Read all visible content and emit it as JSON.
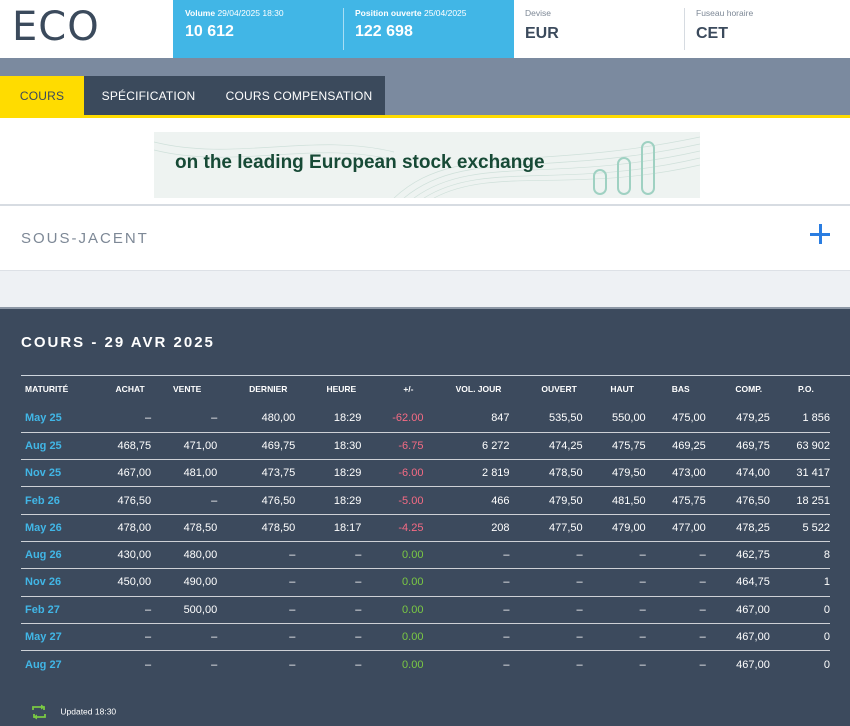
{
  "header": {
    "code": "ECO",
    "volume": {
      "label": "Volume",
      "date": "29/04/2025 18:30",
      "value": "10 612"
    },
    "open_interest": {
      "label": "Position ouverte",
      "date": "25/04/2025",
      "value": "122 698"
    },
    "currency": {
      "label": "Devise",
      "value": "EUR"
    },
    "timezone": {
      "label": "Fuseau horaire",
      "value": "CET"
    }
  },
  "tabs": [
    {
      "label": "COURS",
      "active": true
    },
    {
      "label": "SPÉCIFICATION",
      "active": false
    },
    {
      "label": "COURS COMPENSATION",
      "active": false
    }
  ],
  "banner": {
    "text": "on the leading European stock exchange"
  },
  "underlying": {
    "title": "SOUS-JACENT"
  },
  "prices": {
    "title": "COURS - 29 AVR 2025",
    "columns": [
      "MATURITÉ",
      "ACHAT",
      "VENTE",
      "DERNIER",
      "HEURE",
      "+/-",
      "VOL. JOUR",
      "OUVERT",
      "HAUT",
      "BAS",
      "COMP.",
      "P.O."
    ],
    "rows": [
      {
        "maturity": "May 25",
        "bid": "–",
        "ask": "–",
        "last": "480,00",
        "time": "18:29",
        "change": "-62.00",
        "volume": "847",
        "open": "535,50",
        "high": "550,00",
        "low": "475,00",
        "settle": "479,25",
        "oi": "1 856",
        "dir": "neg"
      },
      {
        "maturity": "Aug 25",
        "bid": "468,75",
        "ask": "471,00",
        "last": "469,75",
        "time": "18:30",
        "change": "-6.75",
        "volume": "6 272",
        "open": "474,25",
        "high": "475,75",
        "low": "469,25",
        "settle": "469,75",
        "oi": "63 902",
        "dir": "neg"
      },
      {
        "maturity": "Nov 25",
        "bid": "467,00",
        "ask": "481,00",
        "last": "473,75",
        "time": "18:29",
        "change": "-6.00",
        "volume": "2 819",
        "open": "478,50",
        "high": "479,50",
        "low": "473,00",
        "settle": "474,00",
        "oi": "31 417",
        "dir": "neg"
      },
      {
        "maturity": "Feb 26",
        "bid": "476,50",
        "ask": "–",
        "last": "476,50",
        "time": "18:29",
        "change": "-5.00",
        "volume": "466",
        "open": "479,50",
        "high": "481,50",
        "low": "475,75",
        "settle": "476,50",
        "oi": "18 251",
        "dir": "neg"
      },
      {
        "maturity": "May 26",
        "bid": "478,00",
        "ask": "478,50",
        "last": "478,50",
        "time": "18:17",
        "change": "-4.25",
        "volume": "208",
        "open": "477,50",
        "high": "479,00",
        "low": "477,00",
        "settle": "478,25",
        "oi": "5 522",
        "dir": "neg"
      },
      {
        "maturity": "Aug 26",
        "bid": "430,00",
        "ask": "480,00",
        "last": "–",
        "time": "–",
        "change": "0.00",
        "volume": "–",
        "open": "–",
        "high": "–",
        "low": "–",
        "settle": "462,75",
        "oi": "8",
        "dir": "pos"
      },
      {
        "maturity": "Nov 26",
        "bid": "450,00",
        "ask": "490,00",
        "last": "–",
        "time": "–",
        "change": "0.00",
        "volume": "–",
        "open": "–",
        "high": "–",
        "low": "–",
        "settle": "464,75",
        "oi": "1",
        "dir": "pos"
      },
      {
        "maturity": "Feb 27",
        "bid": "–",
        "ask": "500,00",
        "last": "–",
        "time": "–",
        "change": "0.00",
        "volume": "–",
        "open": "–",
        "high": "–",
        "low": "–",
        "settle": "467,00",
        "oi": "0",
        "dir": "pos"
      },
      {
        "maturity": "May 27",
        "bid": "–",
        "ask": "–",
        "last": "–",
        "time": "–",
        "change": "0.00",
        "volume": "–",
        "open": "–",
        "high": "–",
        "low": "–",
        "settle": "467,00",
        "oi": "0",
        "dir": "pos"
      },
      {
        "maturity": "Aug 27",
        "bid": "–",
        "ask": "–",
        "last": "–",
        "time": "–",
        "change": "0.00",
        "volume": "–",
        "open": "–",
        "high": "–",
        "low": "–",
        "settle": "467,00",
        "oi": "0",
        "dir": "pos"
      }
    ],
    "updated": "Updated 18:30"
  },
  "icons": {
    "expand": "plus-icon",
    "refresh": "refresh-icon"
  },
  "colors": {
    "accent_blue": "#41b6e6",
    "tab_yellow": "#ffdc00",
    "panel_bg": "#3c4a5d",
    "negative": "#f56b84",
    "positive": "#7ac943",
    "link_blue": "#2a7de1"
  }
}
